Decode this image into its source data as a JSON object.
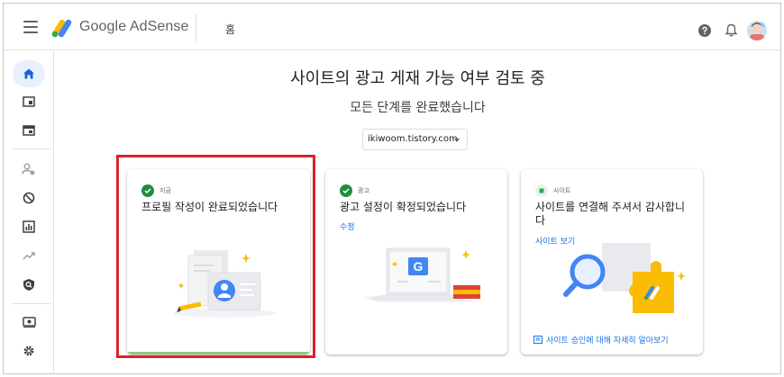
{
  "header": {
    "brand": "Google AdSense",
    "breadcrumb": "홈"
  },
  "sidebar": {
    "items": [
      "home-icon",
      "ads-icon",
      "sites-icon",
      "people-icon",
      "block-icon",
      "reports-icon",
      "trending-icon",
      "policy-icon",
      "payments-icon",
      "settings-icon"
    ]
  },
  "main": {
    "title": "사이트의 광고 게재 가능 여부 검토 중",
    "subtitle": "모든 단계를 완료했습니다",
    "site_select": "ikiwoom.tistory.com"
  },
  "cards": [
    {
      "status": "지금",
      "title": "프로필 작성이 완료되었습니다",
      "link": ""
    },
    {
      "status": "광고",
      "title": "광고 설정이 확정되었습니다",
      "link": "수정"
    },
    {
      "status": "사이트",
      "title": "사이트를 연결해 주셔서 감사합니다",
      "link": "사이트 보기",
      "learn_more": "사이트 승인에 대해 자세히 알아보기"
    }
  ],
  "colors": {
    "accent": "#1a73e8",
    "success": "#1e8e3e",
    "highlight": "#d9232c"
  }
}
